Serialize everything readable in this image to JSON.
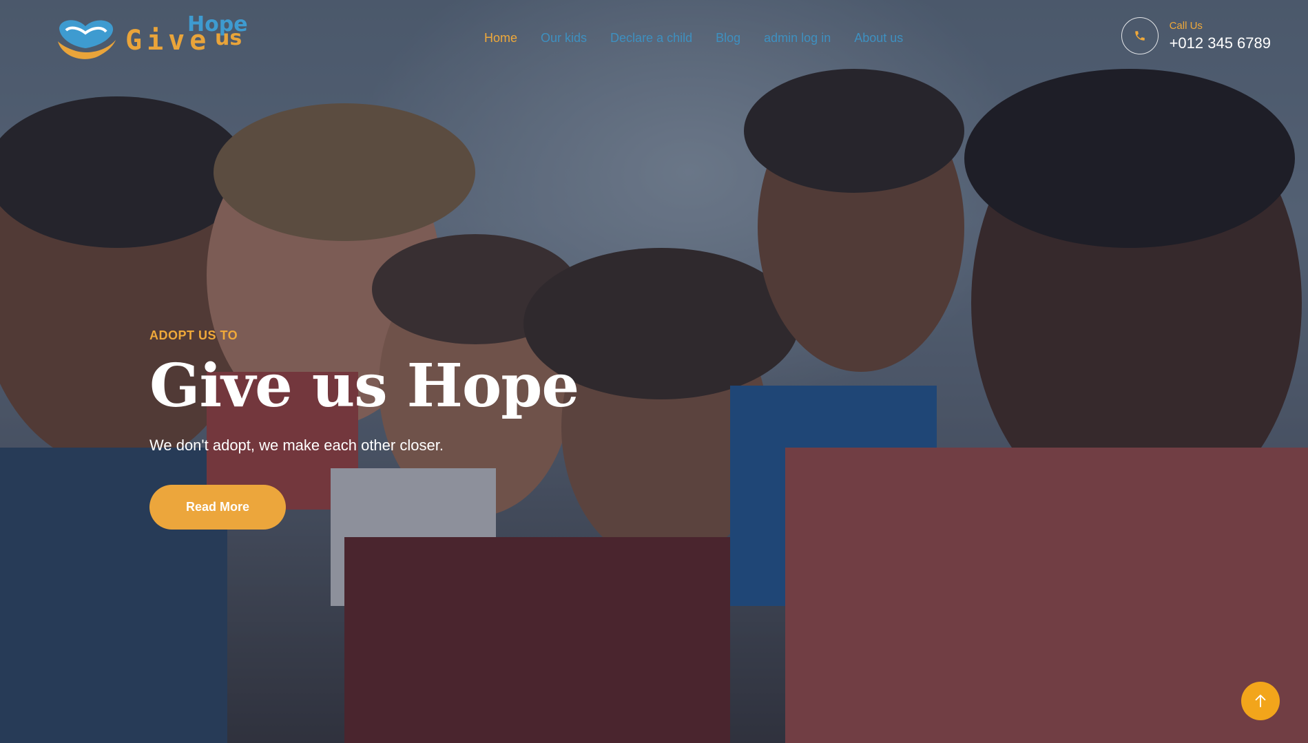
{
  "brand": {
    "logo_give": "Give",
    "logo_hope": "Hope",
    "logo_us": "us"
  },
  "nav": {
    "items": [
      {
        "label": "Home",
        "active": true
      },
      {
        "label": "Our kids",
        "active": false
      },
      {
        "label": "Declare a child",
        "active": false
      },
      {
        "label": "Blog",
        "active": false
      },
      {
        "label": "admin log in",
        "active": false
      },
      {
        "label": "About us",
        "active": false
      }
    ]
  },
  "contact": {
    "label": "Call Us",
    "phone": "+012 345 6789",
    "icon": "phone-icon"
  },
  "hero": {
    "eyebrow": "ADOPT US TO",
    "title": "Give us Hope",
    "subtitle": "We don't adopt, we make each other closer.",
    "button_label": "Read More",
    "background": "group-of-smiling-children-photo"
  },
  "scroll_top": {
    "icon": "arrow-up-icon"
  },
  "colors": {
    "accent": "#eca63c",
    "link": "#3e90c0",
    "text": "#ffffff"
  }
}
